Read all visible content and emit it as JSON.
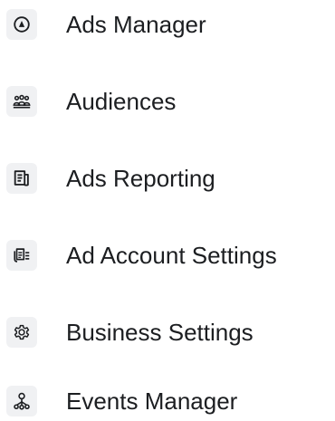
{
  "menu": {
    "items": [
      {
        "label": "Ads Manager",
        "icon": "ads-manager-icon"
      },
      {
        "label": "Audiences",
        "icon": "audiences-icon"
      },
      {
        "label": "Ads Reporting",
        "icon": "ads-reporting-icon"
      },
      {
        "label": "Ad Account Settings",
        "icon": "ad-account-settings-icon"
      },
      {
        "label": "Business Settings",
        "icon": "business-settings-icon"
      },
      {
        "label": "Events Manager",
        "icon": "events-manager-icon"
      }
    ]
  },
  "colors": {
    "text": "#1c1e21",
    "icon": "#1c1e21",
    "icon_background": "#f0f1f3",
    "page_background": "#ffffff"
  }
}
